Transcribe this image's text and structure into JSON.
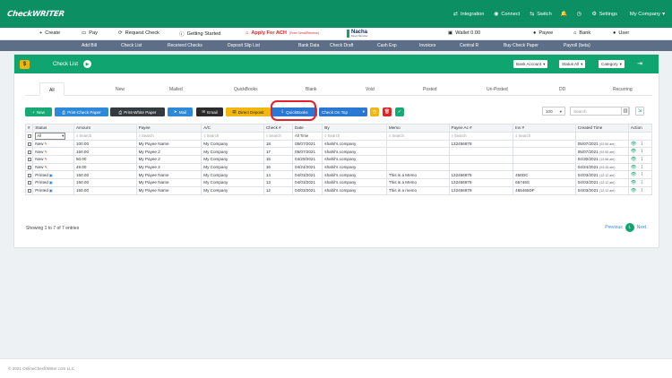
{
  "app": {
    "logo": "CheckWRITER"
  },
  "topnav": [
    {
      "icon": "integration-icon",
      "glyph": "⇄",
      "label": "Integration"
    },
    {
      "icon": "globe-icon",
      "glyph": "◉",
      "label": "Connect"
    },
    {
      "icon": "switch-icon",
      "glyph": "⇆",
      "label": "Switch"
    },
    {
      "icon": "bell-icon",
      "glyph": "🔔",
      "label": ""
    },
    {
      "icon": "clock-icon",
      "glyph": "◷",
      "label": ""
    },
    {
      "icon": "gear-icon",
      "glyph": "⚙",
      "label": "Settings"
    }
  ],
  "company": "My Company",
  "bar2": {
    "create": "Create",
    "pay": "Pay",
    "request_check": "Request Check",
    "getting_started": "Getting Started",
    "apply_ach": "Apply For ACH",
    "apply_ach_note": "(Free Send/Receive)",
    "nacha": "Nacha",
    "nacha_sub": "Direct Member",
    "wallet": "Wallet 0.00",
    "payee": "Payee",
    "bank": "Bank",
    "user": "User"
  },
  "menu": [
    "Add Bill",
    "Check List",
    "Received Checks",
    "Deposit Slip List",
    "Bank Data",
    "Check Draft",
    "Cash Exp",
    "Invoices",
    "Central R",
    "Buy Check Paper",
    "Payroll (beta)"
  ],
  "card": {
    "title": "Check List",
    "filters": [
      "Bank Account",
      "Status All",
      "Category"
    ]
  },
  "tabs": [
    "All",
    "New",
    "Mailed",
    "QuickBooks",
    "Blank",
    "Void",
    "Posted",
    "Un-Posted",
    "DD",
    "Recurring"
  ],
  "actions": {
    "new": "New",
    "print_check_paper": "Print-Check Paper",
    "print_white_paper": "Print-White Paper",
    "mail": "Mail",
    "email": "Email",
    "direct_deposit": "Direct Deposit",
    "quickbooks": "QuickBooks",
    "check_on_top": "Check On Top"
  },
  "page_size": "100",
  "search_placeholder": "Search",
  "columns": [
    "#",
    "Status",
    "Amount",
    "Payee",
    "A/C",
    "Check #",
    "Date",
    "By",
    "Memo",
    "Payee Ac #",
    "Inv #",
    "Created Time",
    "Action"
  ],
  "filter_row": {
    "status": "All",
    "search": "Search",
    "date": "All Time"
  },
  "rows": [
    {
      "status": "New",
      "amount": "100.00",
      "payee": "My Payee Name",
      "ac": "My Company",
      "check": "18",
      "date": "05/07/2021",
      "by": "shahil's company",
      "memo": "",
      "payee_ac": "132456878",
      "inv": "",
      "created": "05/07/2021",
      "created_t": "(02:56 am)"
    },
    {
      "status": "New",
      "amount": "150.00",
      "payee": "My Payee 2",
      "ac": "My Company",
      "check": "17",
      "date": "05/07/2021",
      "by": "shahil's company",
      "memo": "",
      "payee_ac": "",
      "inv": "",
      "created": "05/07/2021",
      "created_t": "(02:55 am)"
    },
    {
      "status": "New",
      "amount": "50.00",
      "payee": "My Payee 2",
      "ac": "My Company",
      "check": "15",
      "date": "04/29/2021",
      "by": "shahil's company",
      "memo": "",
      "payee_ac": "",
      "inv": "",
      "created": "04/30/2021",
      "created_t": "(12:58 am)"
    },
    {
      "status": "New",
      "amount": "49.00",
      "payee": "My Payee 2",
      "ac": "My Company",
      "check": "16",
      "date": "04/24/2021",
      "by": "shahil's company",
      "memo": "",
      "payee_ac": "",
      "inv": "",
      "created": "04/24/2021",
      "created_t": "(03:35 am)"
    },
    {
      "status": "Printed",
      "amount": "150.00",
      "payee": "My Payee Name",
      "ac": "My Company",
      "check": "14",
      "date": "04/03/2021",
      "by": "shahil's company",
      "memo": "This is a Memo",
      "payee_ac": "132456878",
      "inv": "456DC",
      "created": "04/03/2021",
      "created_t": "(12:12 am)"
    },
    {
      "status": "Printed",
      "amount": "150.00",
      "payee": "My Payee Name",
      "ac": "My Company",
      "check": "13",
      "date": "04/03/2021",
      "by": "shahil's company",
      "memo": "This is a Memo",
      "payee_ac": "132456878",
      "inv": "65746S",
      "created": "04/03/2021",
      "created_t": "(12:12 am)"
    },
    {
      "status": "Printed",
      "amount": "150.00",
      "payee": "My Payee Name",
      "ac": "My Company",
      "check": "12",
      "date": "04/03/2021",
      "by": "shahil's company",
      "memo": "This is a memo",
      "payee_ac": "132456878",
      "inv": "465465DF",
      "created": "04/03/2021",
      "created_t": "(12:12 am)"
    }
  ],
  "showing": "Showing 1 to 7 of 7 entries",
  "pager": {
    "previous": "Previous",
    "current": "1",
    "next": "Next"
  },
  "footer": "© 2021 OnlineCheckWriter.com LLC",
  "colors": {
    "brand": "#0b8f63",
    "header": "#10a470",
    "menu": "#5c6f86",
    "ach": "#e02424"
  }
}
